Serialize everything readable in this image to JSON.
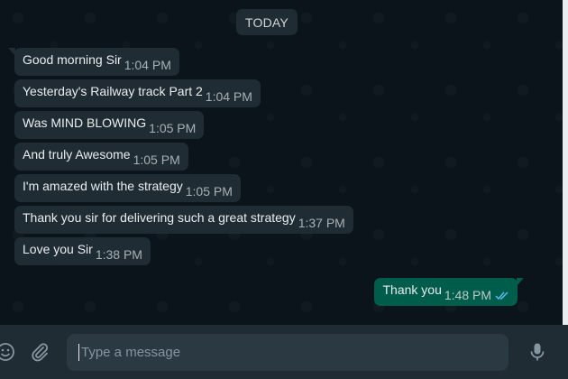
{
  "chat": {
    "date_label": "TODAY",
    "messages": [
      {
        "text": "Good morning Sir",
        "time": "1:04 PM",
        "direction": "incoming"
      },
      {
        "text": "Yesterday's Railway track Part 2",
        "time": "1:04 PM",
        "direction": "incoming"
      },
      {
        "text": "Was MIND BLOWING",
        "time": "1:05 PM",
        "direction": "incoming"
      },
      {
        "text": "And truly Awesome",
        "time": "1:05 PM",
        "direction": "incoming"
      },
      {
        "text": "I'm amazed with the strategy",
        "time": "1:05 PM",
        "direction": "incoming"
      },
      {
        "text": "Thank you sir for delivering such a great strategy",
        "time": "1:37 PM",
        "direction": "incoming"
      },
      {
        "text": "Love you Sir",
        "time": "1:38 PM",
        "direction": "incoming"
      },
      {
        "text": "Thank you",
        "time": "1:48 PM",
        "direction": "outgoing",
        "status": "read"
      }
    ]
  },
  "composer": {
    "placeholder": "Type a message",
    "emoji_icon": "emoji-icon",
    "attach_icon": "paperclip-icon",
    "mic_icon": "microphone-icon"
  },
  "colors": {
    "background": "#0b141a",
    "incoming_bubble": "#202c33",
    "outgoing_bubble": "#005c4b",
    "read_ticks": "#53bdeb"
  }
}
